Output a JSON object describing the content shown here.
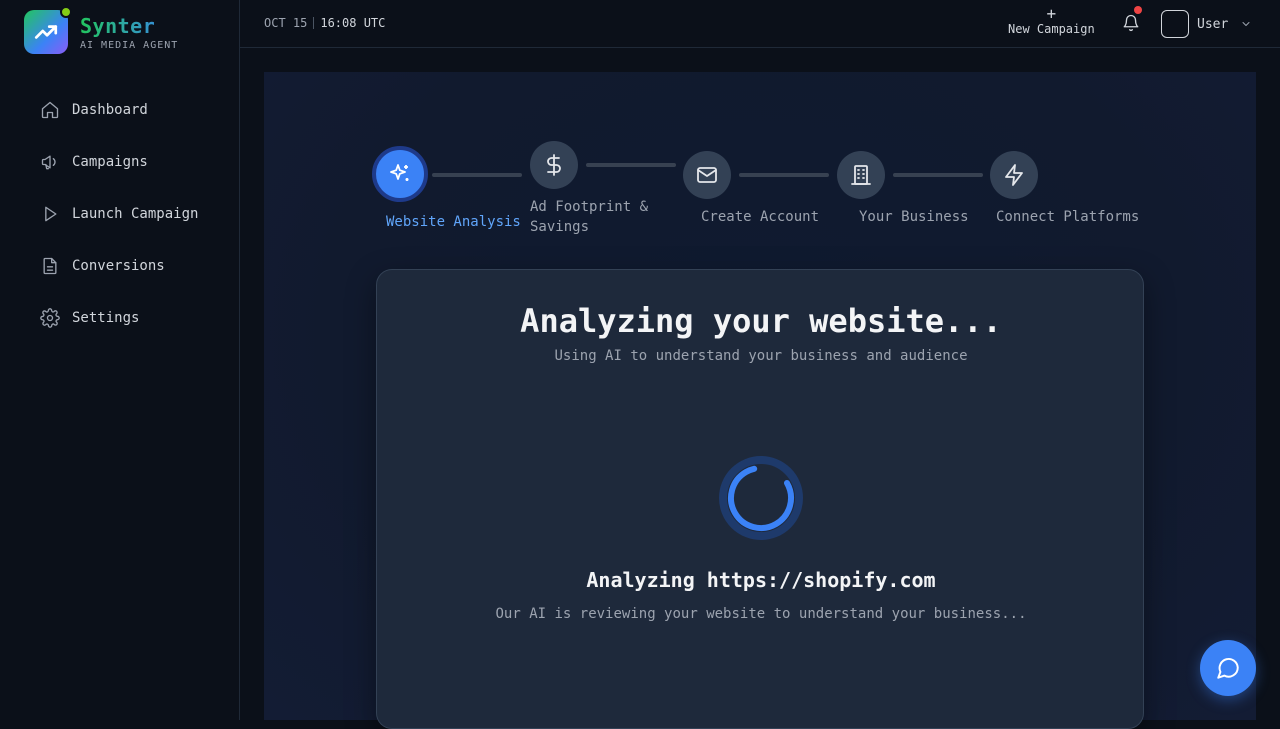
{
  "brand": {
    "name": "Synter",
    "subtitle": "AI MEDIA AGENT"
  },
  "sidebar": {
    "items": [
      {
        "label": "Dashboard",
        "icon": "home-icon"
      },
      {
        "label": "Campaigns",
        "icon": "megaphone-icon"
      },
      {
        "label": "Launch Campaign",
        "icon": "play-icon"
      },
      {
        "label": "Conversions",
        "icon": "document-icon"
      },
      {
        "label": "Settings",
        "icon": "gear-icon"
      }
    ]
  },
  "header": {
    "date": "OCT 15",
    "time": "16:08 UTC",
    "new_campaign_label": "New Campaign",
    "user_label": "User"
  },
  "steps": [
    {
      "label": "Website Analysis",
      "icon": "sparkles-icon",
      "active": true
    },
    {
      "label": "Ad Footprint & Savings",
      "icon": "dollar-icon",
      "active": false
    },
    {
      "label": "Create Account",
      "icon": "mail-icon",
      "active": false
    },
    {
      "label": "Your Business",
      "icon": "building-icon",
      "active": false
    },
    {
      "label": "Connect Platforms",
      "icon": "lightning-icon",
      "active": false
    }
  ],
  "card": {
    "title": "Analyzing your website...",
    "subtitle": "Using AI to understand your business and audience",
    "status": "Analyzing https://shopify.com",
    "status_sub": "Our AI is reviewing your website to understand your business..."
  },
  "colors": {
    "accent": "#3b82f6",
    "active_step_text": "#60a5fa",
    "notification": "#ef4444"
  }
}
